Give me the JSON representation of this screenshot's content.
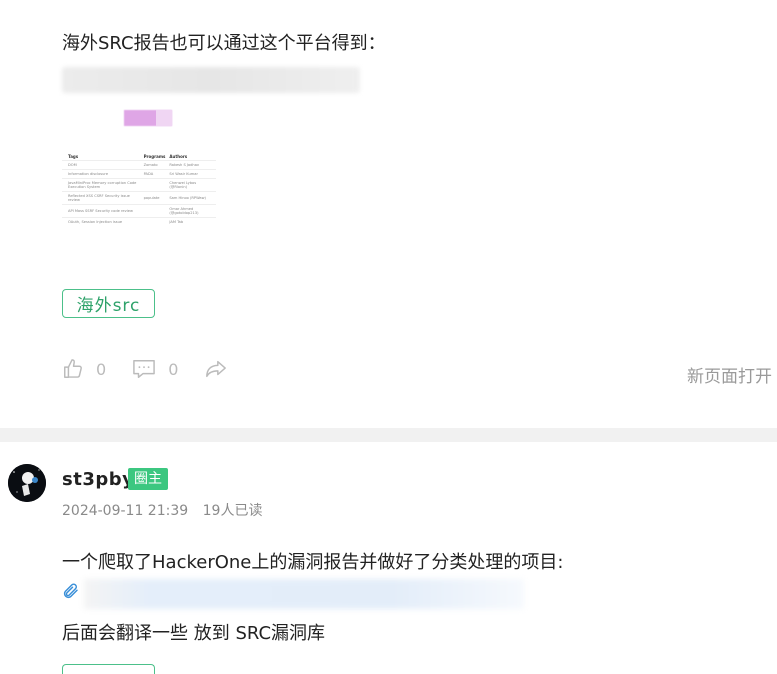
{
  "post1": {
    "text": "海外SRC报告也可以通过这个平台得到：",
    "thumbnail_table": {
      "headers": [
        "",
        "Tags",
        "Programs",
        "Authors"
      ],
      "rows": [
        [
          "",
          "DOM",
          "Zomato",
          "Rakesh S Jadhav"
        ],
        [
          "",
          "Information disclosure",
          "PADA",
          "Sri Wasir Kumar"
        ],
        [
          "",
          "JavaMiniProc Memory corruption Code Execution System",
          "",
          "Chenwei Lybos (@Rlonin)"
        ],
        [
          "",
          "Reflected XSS CSRF Security issue review",
          "populate",
          "Sam Hinoo (RPWaw)"
        ],
        [
          "",
          "API Mass SSRF Security code review",
          "",
          "Omar Ahmed (@gotoldop213)"
        ],
        [
          "",
          "OAuth, Session Injection issue",
          "",
          "JAM Tab"
        ]
      ]
    },
    "tag": "海外src",
    "like_count": "0",
    "comment_count": "0",
    "open_new_page": "新页面打开"
  },
  "post2": {
    "username": "st3pby",
    "badge": "圈主",
    "datetime": "2024-09-11 21:39",
    "reads": "19人已读",
    "text1": "一个爬取了HackerOne上的漏洞报告并做好了分类处理的项目:",
    "text2": "后面会翻译一些 放到 SRC漏洞库"
  },
  "icons": {
    "like": "thumbs-up-icon",
    "comment": "comment-icon",
    "share": "share-icon",
    "attachment": "paperclip-icon"
  },
  "colors": {
    "accent": "#3cc780",
    "tag_border": "#4cc08a",
    "tag_text": "#2ea26a",
    "muted": "#bbbbbb"
  }
}
